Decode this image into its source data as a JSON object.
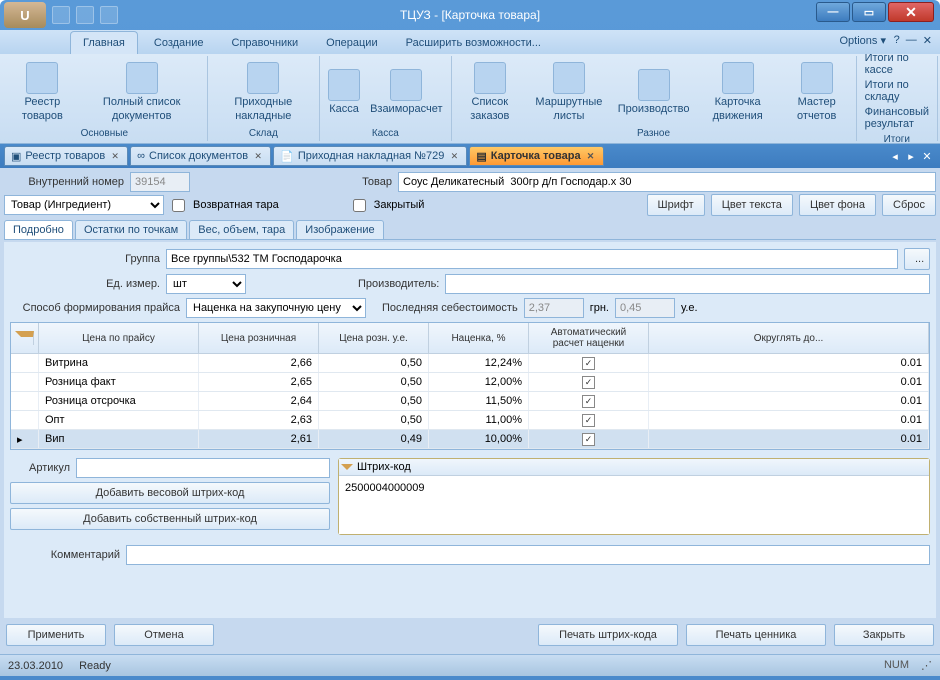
{
  "window": {
    "title": "ТЦУЗ - [Карточка товара]"
  },
  "ribbon_tabs": [
    "Главная",
    "Создание",
    "Справочники",
    "Операции",
    "Расширить возможности..."
  ],
  "options_label": "Options",
  "ribbon_groups": [
    {
      "label": "Основные",
      "items": [
        "Реестр товаров",
        "Полный список документов"
      ]
    },
    {
      "label": "Склад",
      "items": [
        "Приходные накладные"
      ]
    },
    {
      "label": "Касса",
      "items": [
        "Касса",
        "Взаиморасчет"
      ]
    },
    {
      "label": "Разное",
      "items": [
        "Список заказов",
        "Маршрутные листы",
        "Производство",
        "Карточка движения",
        "Мастер отчетов"
      ]
    }
  ],
  "ribbon_side_label": "Итоги",
  "side_links": [
    "Итоги по кассе",
    "Итоги по складу",
    "Финансовый результат"
  ],
  "doc_tabs": [
    {
      "label": "Реестр товаров"
    },
    {
      "label": "Список документов"
    },
    {
      "label": "Приходная накладная №729"
    },
    {
      "label": "Карточка товара",
      "active": true
    }
  ],
  "form": {
    "internal_num_label": "Внутренний номер",
    "internal_num": "39154",
    "product_label": "Товар",
    "product": "Соус Деликатесный  300гр д/п Господар.х 30",
    "type": "Товар (Ингредиент)",
    "return_label": "Возвратная тара",
    "closed_label": "Закрытый",
    "font_btn": "Шрифт",
    "textcolor_btn": "Цвет текста",
    "bgcolor_btn": "Цвет фона",
    "reset_btn": "Сброс",
    "group_label": "Группа",
    "group": "Все группы\\532 ТМ Господарочка",
    "unit_label": "Ед. измер.",
    "unit": "шт",
    "maker_label": "Производитель:",
    "price_method_label": "Способ формирования прайса",
    "price_method": "Наценка на закупочную цену",
    "last_cost_label": "Последняя себестоимость",
    "last_cost": "2,37",
    "currency_grn": "грн.",
    "last_cost_ue": "0,45",
    "currency_ue": "у.е.",
    "article_label": "Артикул",
    "barcode_btn1": "Добавить весовой штрих-код",
    "barcode_btn2": "Добавить собственный штрих-код",
    "barcode_head": "Штрих-код",
    "barcode_value": "2500004000009",
    "comment_label": "Комментарий"
  },
  "inner_tabs": [
    "Подробно",
    "Остатки по точкам",
    "Вес, объем, тара",
    "Изображение"
  ],
  "grid": {
    "headers": [
      "Цена по прайсу",
      "Цена розничная",
      "Цена розн. у.е.",
      "Наценка, %",
      "Автоматический расчет наценки",
      "Округлять до..."
    ],
    "rows": [
      {
        "name": "Витрина",
        "retail": "2,66",
        "ue": "0,50",
        "markup": "12,24%",
        "auto": true,
        "round": "0.01"
      },
      {
        "name": "Розница факт",
        "retail": "2,65",
        "ue": "0,50",
        "markup": "12,00%",
        "auto": true,
        "round": "0.01"
      },
      {
        "name": "Розница отсрочка",
        "retail": "2,64",
        "ue": "0,50",
        "markup": "11,50%",
        "auto": true,
        "round": "0.01"
      },
      {
        "name": "Опт",
        "retail": "2,63",
        "ue": "0,50",
        "markup": "11,00%",
        "auto": true,
        "round": "0.01"
      },
      {
        "name": "Вип",
        "retail": "2,61",
        "ue": "0,49",
        "markup": "10,00%",
        "auto": true,
        "round": "0.01"
      }
    ]
  },
  "bottom_buttons": {
    "apply": "Применить",
    "cancel": "Отмена",
    "print_barcode": "Печать штрих-кода",
    "print_price": "Печать ценника",
    "close": "Закрыть"
  },
  "status": {
    "date": "23.03.2010",
    "ready": "Ready",
    "num": "NUM"
  }
}
